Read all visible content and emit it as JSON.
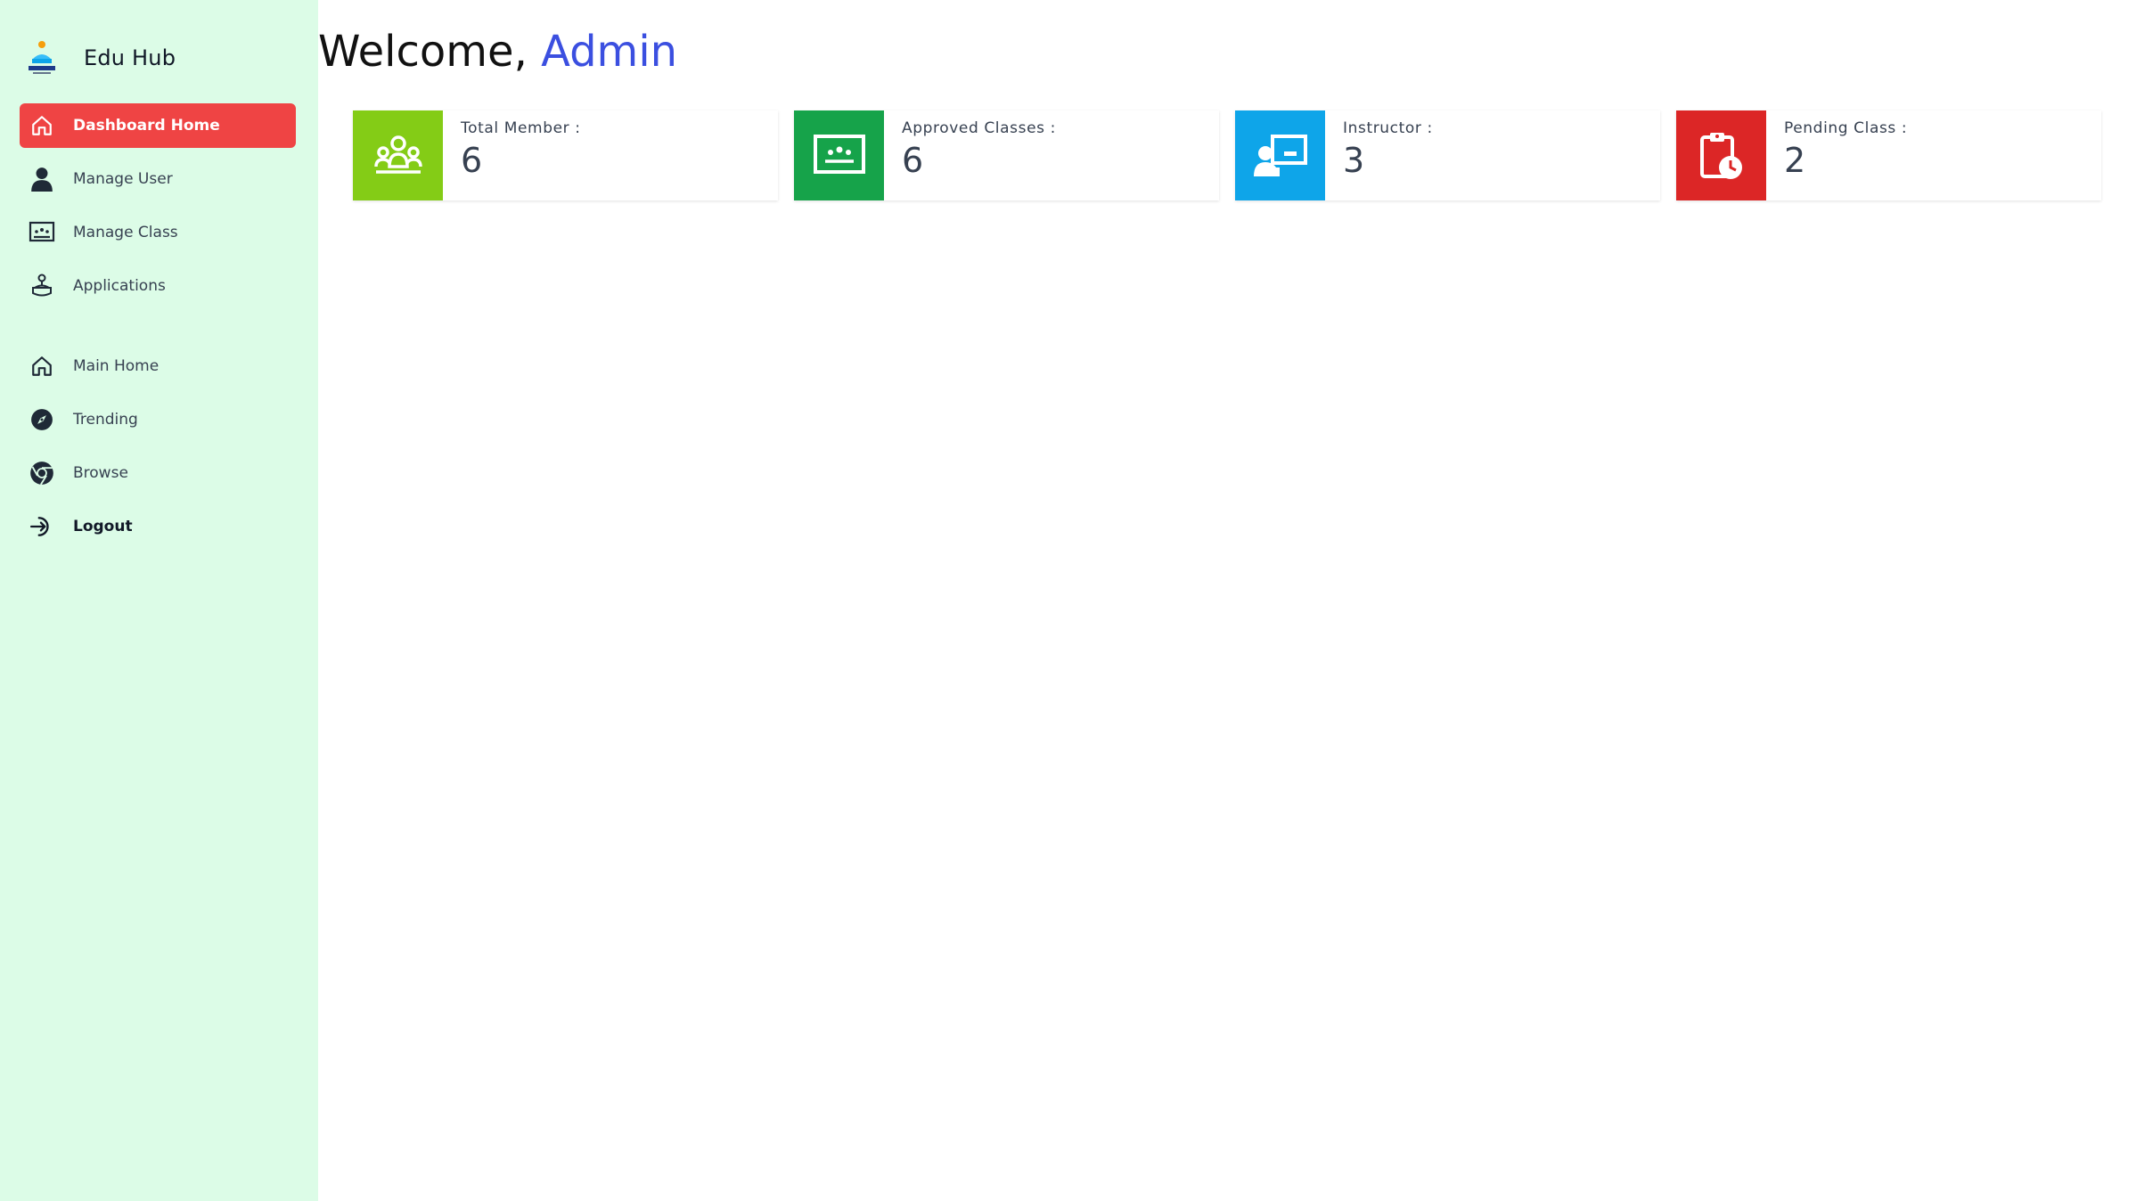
{
  "brand": {
    "name": "Edu Hub",
    "logo_text": "EDU HUB"
  },
  "sidebar": {
    "items": [
      {
        "label": "Dashboard Home",
        "icon": "home-icon",
        "active": true
      },
      {
        "label": "Manage User",
        "icon": "user-icon",
        "active": false
      },
      {
        "label": "Manage Class",
        "icon": "classroom-icon",
        "active": false
      },
      {
        "label": "Applications",
        "icon": "applications-icon",
        "active": false
      }
    ],
    "secondary_items": [
      {
        "label": "Main Home",
        "icon": "home-icon"
      },
      {
        "label": "Trending",
        "icon": "compass-icon"
      },
      {
        "label": "Browse",
        "icon": "chrome-icon"
      },
      {
        "label": "Logout",
        "icon": "logout-icon"
      }
    ]
  },
  "header": {
    "greeting": "Welcome,",
    "user_name": "Admin"
  },
  "stats": [
    {
      "label": "Total Member :",
      "value": "6",
      "color": "#84cc16",
      "icon": "group-icon"
    },
    {
      "label": "Approved Classes :",
      "value": "6",
      "color": "#16a34a",
      "icon": "classroom-board-icon"
    },
    {
      "label": "Instructor :",
      "value": "3",
      "color": "#0ea5e9",
      "icon": "instructor-icon"
    },
    {
      "label": "Pending Class :",
      "value": "2",
      "color": "#dc2626",
      "icon": "clipboard-clock-icon"
    }
  ],
  "colors": {
    "sidebar_bg": "#dcfce7",
    "active_item": "#ef4444",
    "accent_name": "#3b4fe0"
  }
}
